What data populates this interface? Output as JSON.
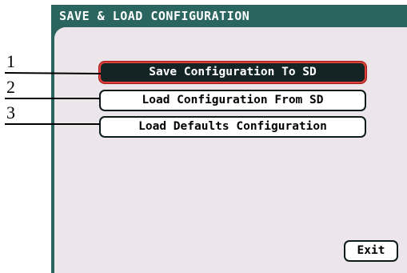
{
  "header": {
    "title": "SAVE & LOAD CONFIGURATION"
  },
  "menu": {
    "items": [
      {
        "label": "Save Configuration To SD",
        "selected": true
      },
      {
        "label": "Load Configuration From SD",
        "selected": false
      },
      {
        "label": "Load Defaults Configuration",
        "selected": false
      }
    ]
  },
  "footer": {
    "exit_label": "Exit"
  },
  "callouts": [
    "1",
    "2",
    "3"
  ],
  "colors": {
    "header_bg": "#2b6560",
    "panel_bg": "#ece6ea",
    "selected_bg": "#142424",
    "selected_border": "#e0403a"
  }
}
